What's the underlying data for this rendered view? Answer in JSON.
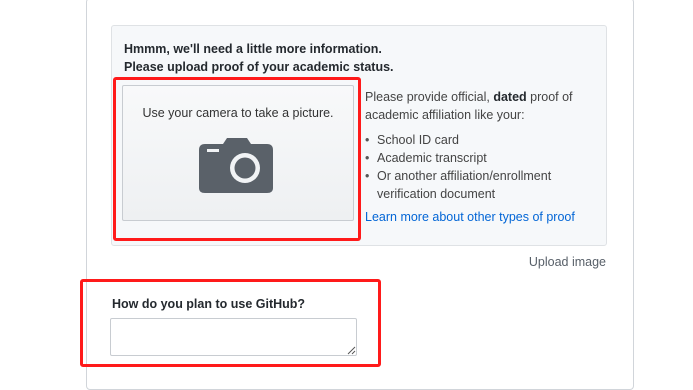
{
  "verification": {
    "heading_line1": "Hmmm, we'll need a little more information.",
    "heading_line2": "Please upload proof of your academic status.",
    "camera_prompt": "Use your camera to take a picture.",
    "camera_icon": "camera-icon",
    "description_prefix": "Please provide official, ",
    "description_bold": "dated",
    "description_suffix": " proof of academic affiliation like your:",
    "proof_items": [
      "School ID card",
      "Academic transcript",
      "Or another affiliation/enrollment verification document"
    ],
    "learn_more_link": "Learn more about other types of proof",
    "upload_link": "Upload image"
  },
  "usage_question": {
    "label": "How do you plan to use GitHub?",
    "value": "",
    "placeholder": ""
  },
  "colors": {
    "highlight": "#ff1a1a",
    "link": "#0366d6",
    "info_box_bg": "#f6f8fa",
    "camera_icon": "#5a6169"
  }
}
